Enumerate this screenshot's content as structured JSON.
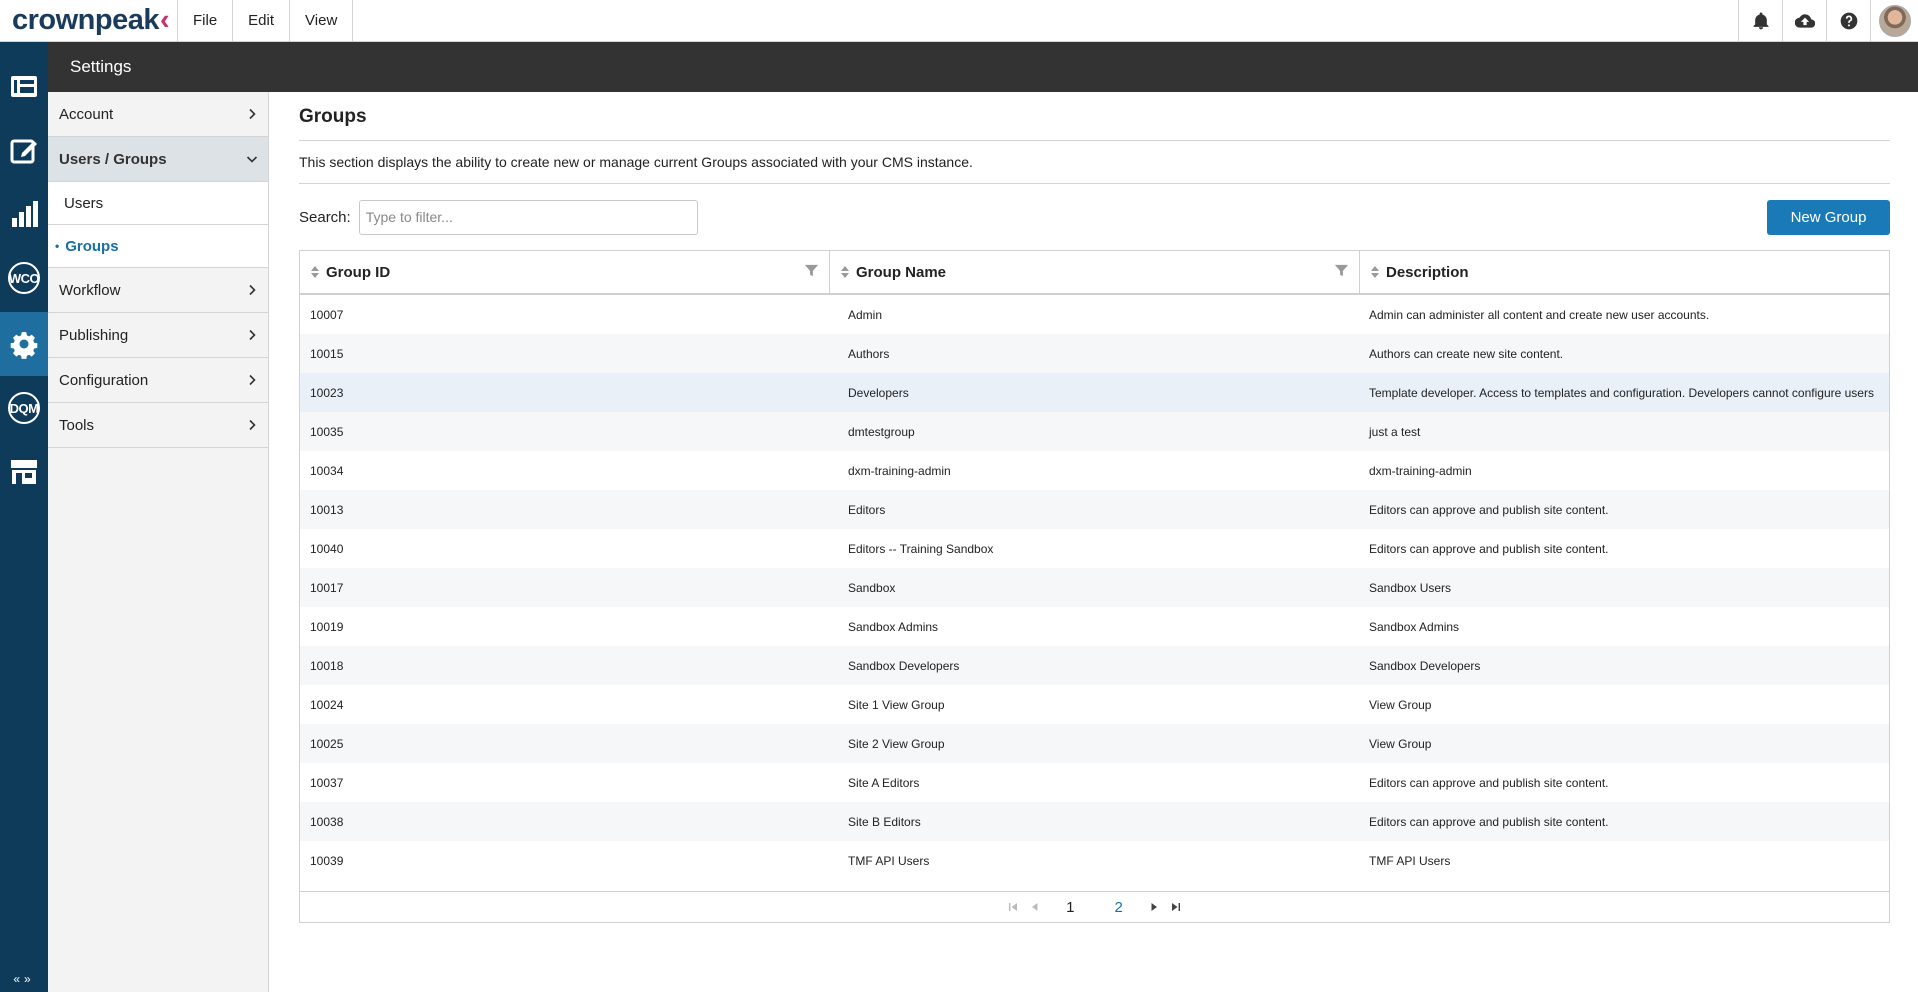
{
  "app": {
    "logo_text": "crownpeak",
    "menu": [
      "File",
      "Edit",
      "View"
    ],
    "top_icons": [
      "bell-icon",
      "cloud-upload-icon",
      "help-icon"
    ],
    "colors": {
      "rail": "#0f3b5a",
      "active": "#1e6f9f",
      "accent": "#1a7ab8",
      "brand_pink": "#c8306f"
    }
  },
  "header": {
    "title": "Settings"
  },
  "sidebar": {
    "items": [
      {
        "label": "Account"
      },
      {
        "label": "Users / Groups"
      },
      {
        "label": "Workflow"
      },
      {
        "label": "Publishing"
      },
      {
        "label": "Configuration"
      },
      {
        "label": "Tools"
      }
    ],
    "subitems": [
      {
        "label": "Users"
      },
      {
        "label": "Groups",
        "marker": "•"
      }
    ]
  },
  "main": {
    "title": "Groups",
    "description": "This section displays the ability to create new or manage current Groups associated with your CMS instance.",
    "search": {
      "label": "Search:",
      "placeholder": "Type to filter..."
    },
    "new_button": "New Group",
    "columns": [
      "Group ID",
      "Group Name",
      "Description"
    ],
    "rows": [
      [
        "10007",
        "Admin",
        "Admin can administer all content and create new user accounts."
      ],
      [
        "10015",
        "Authors",
        "Authors can create new site content."
      ],
      [
        "10023",
        "Developers",
        "Template developer. Access to templates and configuration. Developers cannot configure users"
      ],
      [
        "10035",
        "dmtestgroup",
        "just a test"
      ],
      [
        "10034",
        "dxm-training-admin",
        "dxm-training-admin"
      ],
      [
        "10013",
        "Editors",
        "Editors can approve and publish site content."
      ],
      [
        "10040",
        "Editors -- Training Sandbox",
        "Editors can approve and publish site content."
      ],
      [
        "10017",
        "Sandbox",
        "Sandbox Users"
      ],
      [
        "10019",
        "Sandbox Admins",
        "Sandbox Admins"
      ],
      [
        "10018",
        "Sandbox Developers",
        "Sandbox Developers"
      ],
      [
        "10024",
        "Site 1 View Group",
        "View Group"
      ],
      [
        "10025",
        "Site 2 View Group",
        "View Group"
      ],
      [
        "10037",
        "Site A Editors",
        "Editors can approve and publish site content."
      ],
      [
        "10038",
        "Site B Editors",
        "Editors can approve and publish site content."
      ],
      [
        "10039",
        "TMF API Users",
        "TMF API Users"
      ]
    ],
    "pager": {
      "pages": [
        "1",
        "2"
      ],
      "current": "1"
    }
  }
}
